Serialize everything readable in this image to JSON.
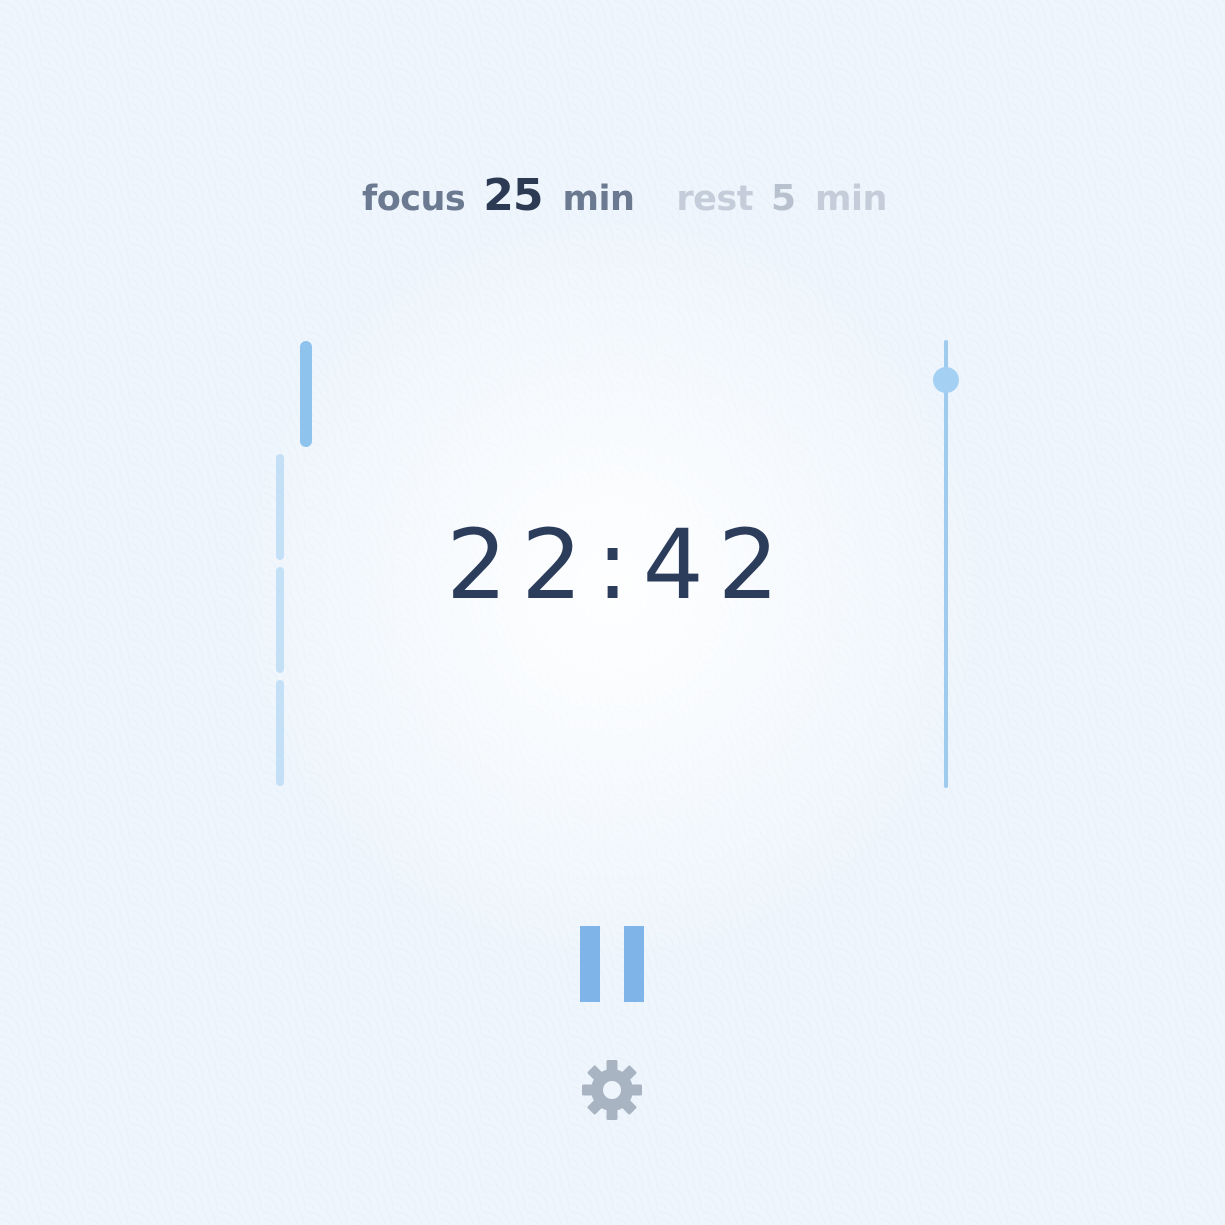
{
  "session": {
    "focus": {
      "label": "focus",
      "minutes": "25",
      "unit": "min"
    },
    "rest": {
      "label": "rest",
      "minutes": "5",
      "unit": "min"
    }
  },
  "timer": {
    "display": "22:42"
  },
  "segments": {
    "total": 4,
    "active_index": 0
  },
  "slider": {
    "level": 0.09
  },
  "controls": {
    "pause_icon": "pause-icon",
    "settings_icon": "gear-icon"
  },
  "colors": {
    "accent": "#7eb4e8",
    "accent_light": "#c4e0f7",
    "text_dark": "#2c3d5b",
    "text_muted": "#6b7a90",
    "text_inactive": "#c4cdd9",
    "icon_gray": "#a9b4c2"
  }
}
